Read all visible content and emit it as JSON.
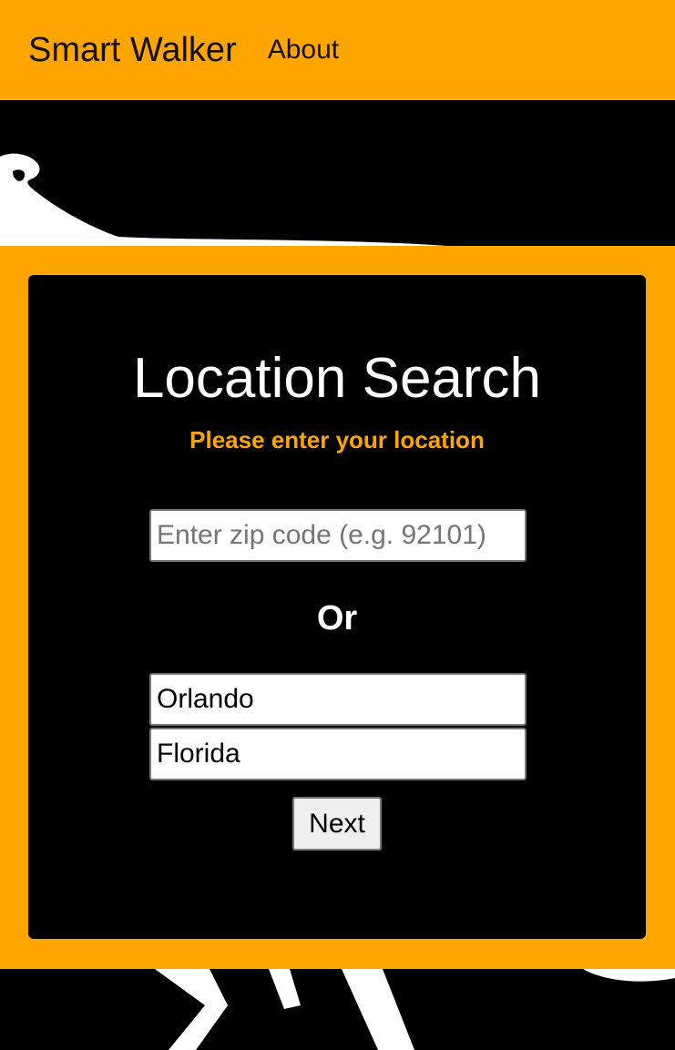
{
  "navbar": {
    "brand": "Smart Walker",
    "links": [
      {
        "label": "About"
      }
    ],
    "background_color": "#FFA500"
  },
  "location_search": {
    "title": "Location Search",
    "subtitle": "Please enter your location",
    "zip_input": {
      "placeholder": "Enter zip code (e.g. 92101)",
      "value": ""
    },
    "separator": "Or",
    "city_input": {
      "value": "Orlando"
    },
    "state_input": {
      "value": "Florida"
    },
    "next_button": "Next",
    "accent_color": "#FFA500"
  }
}
